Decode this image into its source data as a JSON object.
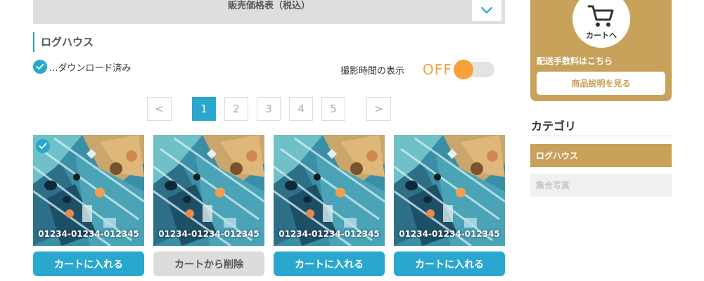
{
  "price_table": {
    "label": "販売価格表（税込）",
    "icon": "chevron-down-icon"
  },
  "section": {
    "title": "ログハウス"
  },
  "download_legend": {
    "label": "...ダウンロード済み",
    "icon": "check-icon"
  },
  "shooting_time": {
    "label": "撮影時間の表示",
    "state": "OFF",
    "enabled": false
  },
  "pagination": {
    "prev_label": "<",
    "next_label": ">",
    "pages": [
      "1",
      "2",
      "3",
      "4",
      "5"
    ],
    "current": "1"
  },
  "photos": [
    {
      "code": "01234-01234-012345",
      "downloaded": true,
      "button": "カートに入れる"
    },
    {
      "code": "01234-01234-012345",
      "downloaded": false,
      "button": "カートから削除"
    },
    {
      "code": "01234-01234-012345",
      "downloaded": false,
      "button": "カートに入れる"
    },
    {
      "code": "01234-01234-012345",
      "downloaded": false,
      "button": "カートに入れる"
    }
  ],
  "sidebar": {
    "cart_label": "カートへ",
    "cart_icon": "cart-icon",
    "shipping_link": "配送手数料はこちら",
    "description_button": "商品説明を見る",
    "category_title": "カテゴリ",
    "categories": [
      "ログハウス",
      "集合写真"
    ]
  },
  "colors": {
    "accent_blue": "#2aa7cf",
    "accent_gold": "#c8a15a",
    "toggle_orange": "#f7a13a"
  }
}
